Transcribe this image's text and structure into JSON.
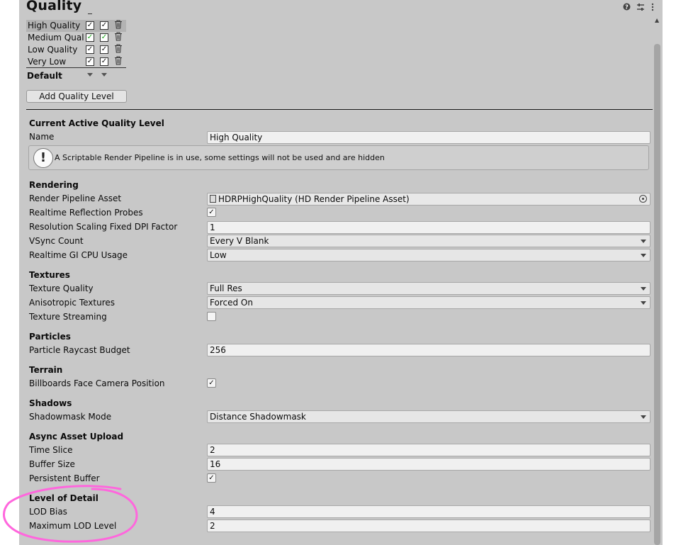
{
  "title": "Quality",
  "header_icons": [
    "help-icon",
    "preset-icon",
    "more-icon"
  ],
  "quality_levels": [
    {
      "name": "High Quality",
      "selected": true,
      "check1": true,
      "check2": true,
      "green": false
    },
    {
      "name": "Medium Quali",
      "selected": false,
      "check1": true,
      "check2": true,
      "green": true
    },
    {
      "name": "Low Quality",
      "selected": false,
      "check1": true,
      "check2": true,
      "green": false
    },
    {
      "name": "Very Low",
      "selected": false,
      "check1": true,
      "check2": true,
      "green": false
    }
  ],
  "default_label": "Default",
  "add_button": "Add Quality Level",
  "current": {
    "heading": "Current Active Quality Level",
    "name_label": "Name",
    "name_value": "High Quality",
    "info_text": "A Scriptable Render Pipeline is in use, some settings will not be used and are hidden",
    "info_icon": "!"
  },
  "rendering": {
    "heading": "Rendering",
    "render_pipeline_label": "Render Pipeline Asset",
    "render_pipeline_value": "HDRPHighQuality (HD Render Pipeline Asset)",
    "reflection_label": "Realtime Reflection Probes",
    "reflection_checked": true,
    "dpi_label": "Resolution Scaling Fixed DPI Factor",
    "dpi_value": "1",
    "vsync_label": "VSync Count",
    "vsync_value": "Every V Blank",
    "gi_label": "Realtime GI CPU Usage",
    "gi_value": "Low"
  },
  "textures": {
    "heading": "Textures",
    "quality_label": "Texture Quality",
    "quality_value": "Full Res",
    "aniso_label": "Anisotropic Textures",
    "aniso_value": "Forced On",
    "streaming_label": "Texture Streaming",
    "streaming_checked": false
  },
  "particles": {
    "heading": "Particles",
    "raycast_label": "Particle Raycast Budget",
    "raycast_value": "256"
  },
  "terrain": {
    "heading": "Terrain",
    "billboards_label": "Billboards Face Camera Position",
    "billboards_checked": true
  },
  "shadows": {
    "heading": "Shadows",
    "mode_label": "Shadowmask Mode",
    "mode_value": "Distance Shadowmask"
  },
  "async": {
    "heading": "Async Asset Upload",
    "time_slice_label": "Time Slice",
    "time_slice_value": "2",
    "buffer_size_label": "Buffer Size",
    "buffer_size_value": "16",
    "persistent_label": "Persistent Buffer",
    "persistent_checked": true
  },
  "lod": {
    "heading": "Level of Detail",
    "bias_label": "LOD Bias",
    "bias_value": "4",
    "max_label": "Maximum LOD Level",
    "max_value": "2"
  },
  "colors": {
    "panel_bg": "#c8c8c8",
    "highlight": "#ff66dd",
    "green_check": "#1aa61a"
  },
  "check_glyph": "✓"
}
